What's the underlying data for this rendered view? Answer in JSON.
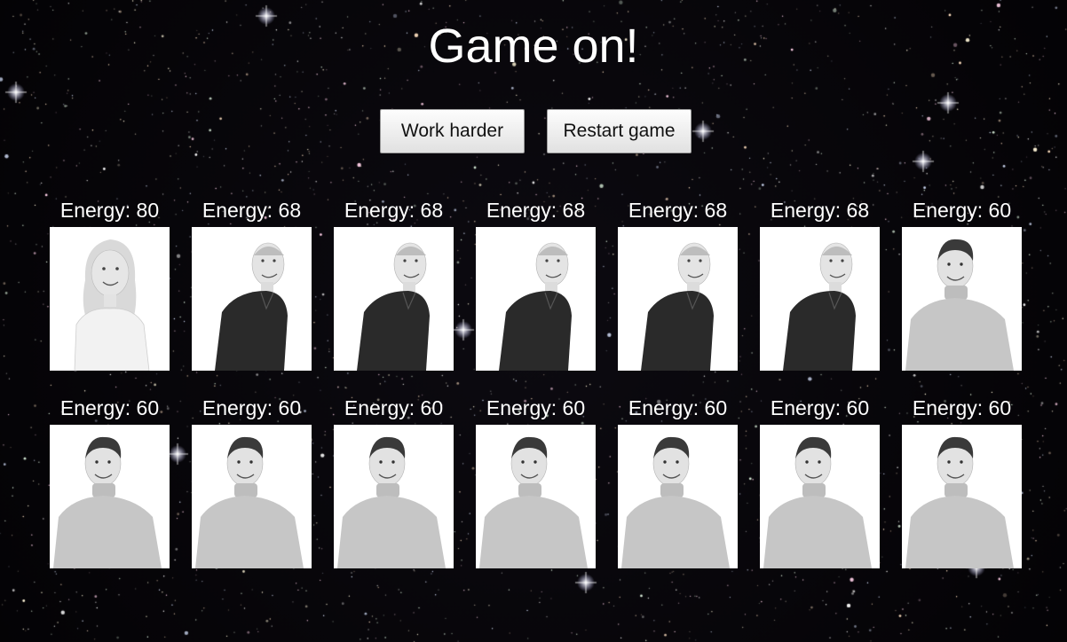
{
  "title": "Game on!",
  "buttons": {
    "work_harder": "Work harder",
    "restart": "Restart game"
  },
  "energy_prefix": "Energy: ",
  "workers": [
    {
      "energy": 80,
      "portrait": "blonde-woman-white-tee"
    },
    {
      "energy": 68,
      "portrait": "man-dark-shirt"
    },
    {
      "energy": 68,
      "portrait": "man-dark-shirt"
    },
    {
      "energy": 68,
      "portrait": "man-dark-shirt"
    },
    {
      "energy": 68,
      "portrait": "man-dark-shirt"
    },
    {
      "energy": 68,
      "portrait": "man-dark-shirt"
    },
    {
      "energy": 60,
      "portrait": "man-grey-turtleneck"
    },
    {
      "energy": 60,
      "portrait": "man-grey-turtleneck"
    },
    {
      "energy": 60,
      "portrait": "man-grey-turtleneck"
    },
    {
      "energy": 60,
      "portrait": "man-grey-turtleneck"
    },
    {
      "energy": 60,
      "portrait": "man-grey-turtleneck"
    },
    {
      "energy": 60,
      "portrait": "man-grey-turtleneck"
    },
    {
      "energy": 60,
      "portrait": "man-grey-turtleneck"
    },
    {
      "energy": 60,
      "portrait": "man-grey-turtleneck"
    }
  ],
  "colors": {
    "background": "#050407",
    "text": "#ffffff"
  }
}
